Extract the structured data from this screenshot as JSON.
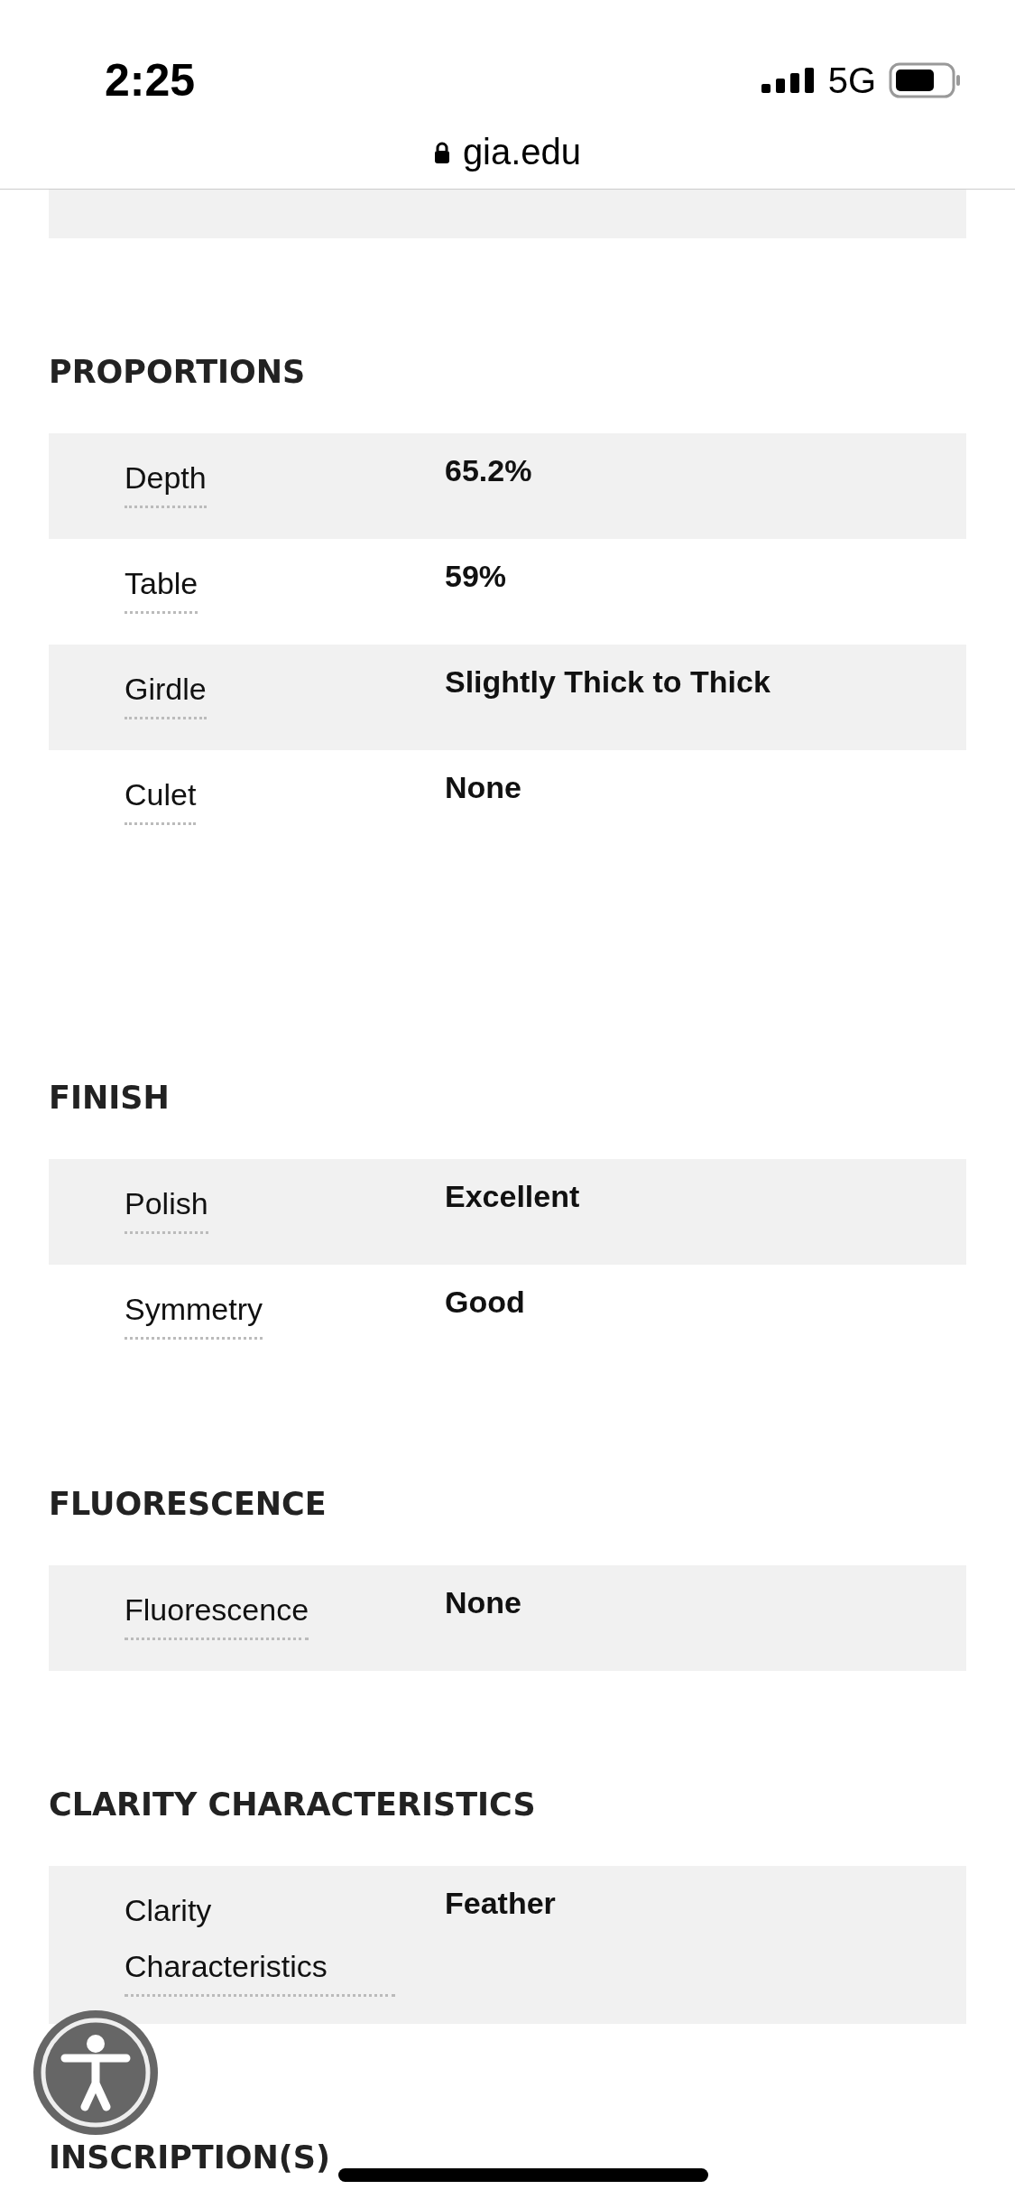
{
  "status_bar": {
    "time": "2:25",
    "network": "5G"
  },
  "address_bar": {
    "url": "gia.edu"
  },
  "sections": [
    {
      "title": "PROPORTIONS",
      "rows": [
        {
          "label": "Depth",
          "value": "65.2%"
        },
        {
          "label": "Table",
          "value": "59%"
        },
        {
          "label": "Girdle",
          "value": "Slightly Thick to Thick"
        },
        {
          "label": "Culet",
          "value": "None"
        }
      ]
    },
    {
      "title": "FINISH",
      "rows": [
        {
          "label": "Polish",
          "value": "Excellent"
        },
        {
          "label": "Symmetry",
          "value": "Good"
        }
      ]
    },
    {
      "title": "FLUORESCENCE",
      "rows": [
        {
          "label": "Fluorescence",
          "value": "None"
        }
      ]
    },
    {
      "title": "CLARITY CHARACTERISTICS",
      "rows": [
        {
          "label": "Clarity Characteristics",
          "value": "Feather"
        }
      ]
    },
    {
      "title": "INSCRIPTION(S)"
    }
  ]
}
